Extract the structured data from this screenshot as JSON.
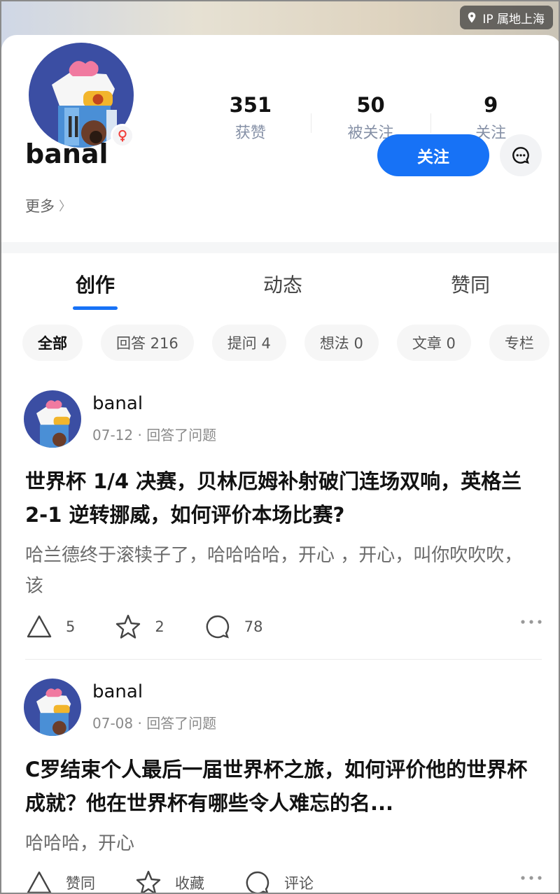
{
  "ip": {
    "label": "IP 属地上海"
  },
  "profile": {
    "username": "banal",
    "gender": "♀",
    "stats": [
      {
        "value": "351",
        "label": "获赞"
      },
      {
        "value": "50",
        "label": "被关注"
      },
      {
        "value": "9",
        "label": "关注"
      }
    ],
    "follow_label": "关注",
    "more_label": "更多",
    "more_chevron": "〉"
  },
  "tabs": [
    {
      "label": "创作",
      "active": true
    },
    {
      "label": "动态",
      "active": false
    },
    {
      "label": "赞同",
      "active": false
    }
  ],
  "chips": [
    {
      "label": "全部",
      "active": true
    },
    {
      "label": "回答 216",
      "active": false
    },
    {
      "label": "提问 4",
      "active": false
    },
    {
      "label": "想法 0",
      "active": false
    },
    {
      "label": "文章 0",
      "active": false
    },
    {
      "label": "专栏",
      "active": false
    }
  ],
  "posts": [
    {
      "author": "banal",
      "meta": "07-12 · 回答了问题",
      "title": "世界杯 1/4 决赛，贝林厄姆补射破门连场双响，英格兰 2-1 逆转挪威，如何评价本场比赛?",
      "excerpt": "哈兰德终于滚犊子了，哈哈哈哈，开心 ，开心，叫你吹吹吹，该",
      "upvote": "5",
      "favorite": "2",
      "comment": "78"
    },
    {
      "author": "banal",
      "meta": "07-08 · 回答了问题",
      "title": "C罗结束个人最后一届世界杯之旅，如何评价他的世界杯成就？他在世界杯有哪些令人难忘的名...",
      "excerpt": "哈哈哈，开心",
      "upvote": "赞同",
      "favorite": "收藏",
      "comment": "评论"
    }
  ]
}
